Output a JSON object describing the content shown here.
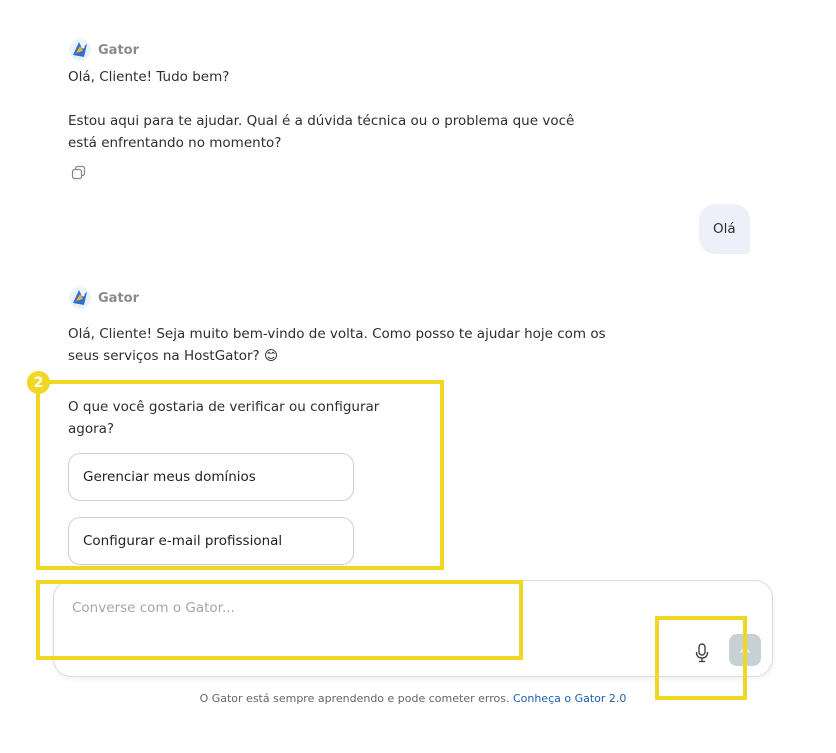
{
  "messages": {
    "bot_name": "Gator",
    "first": {
      "greeting": "Olá, Cliente! Tudo bem?",
      "body": "Estou aqui para te ajudar. Qual é a dúvida técnica ou o problema que você está enfrentando no momento?"
    },
    "user": {
      "text": "Olá"
    },
    "second": {
      "text": "Olá, Cliente! Seja muito bem-vindo de volta. Como posso te ajudar hoje com os seus serviços na HostGator? 😊",
      "question": "O que você gostaria de verificar ou configurar agora?",
      "options": [
        "Gerenciar meus domínios",
        "Configurar e-mail profissional"
      ]
    }
  },
  "annotation": {
    "badge": "2",
    "color": "#f0d724"
  },
  "composer": {
    "placeholder": "Converse com o Gator..."
  },
  "footer": {
    "text": "O Gator está sempre aprendendo e pode cometer erros.",
    "link": "Conheça o Gator 2.0"
  },
  "icons": [
    "gator-logo-icon",
    "copy-icon",
    "microphone-icon",
    "arrow-up-icon",
    "smile-emoji"
  ]
}
